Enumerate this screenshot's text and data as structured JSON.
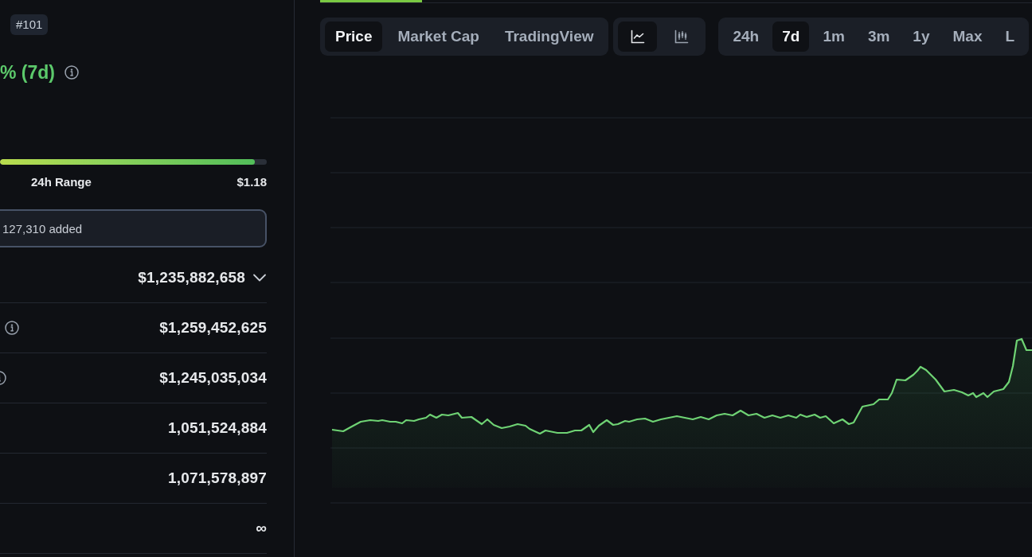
{
  "sidebar": {
    "rank_badge": "#101",
    "change": "% (7d)",
    "range": {
      "level": 0.955,
      "label": "24h Range",
      "high": "$1.18"
    },
    "added_note": "127,310 added",
    "stats": [
      {
        "kind": "dropdown",
        "value": "$1,235,882,658"
      },
      {
        "kind": "info",
        "value": "$1,259,452,625"
      },
      {
        "kind": "info",
        "value": "$1,245,035,034"
      },
      {
        "kind": "plain",
        "value": "1,051,524,884"
      },
      {
        "kind": "plain",
        "value": "1,071,578,897"
      },
      {
        "kind": "plain",
        "value": "∞"
      }
    ]
  },
  "chart_panel": {
    "views": [
      {
        "label": "Price",
        "selected": true
      },
      {
        "label": "Market Cap",
        "selected": false
      },
      {
        "label": "TradingView",
        "selected": false
      }
    ],
    "chart_types": [
      {
        "kind": "line",
        "selected": true
      },
      {
        "kind": "candlestick",
        "selected": false
      }
    ],
    "ranges": [
      {
        "label": "24h",
        "selected": false
      },
      {
        "label": "7d",
        "selected": true
      },
      {
        "label": "1m",
        "selected": false
      },
      {
        "label": "3m",
        "selected": false
      },
      {
        "label": "1y",
        "selected": false
      },
      {
        "label": "Max",
        "selected": false
      },
      {
        "label": "L",
        "selected": false
      }
    ]
  }
}
